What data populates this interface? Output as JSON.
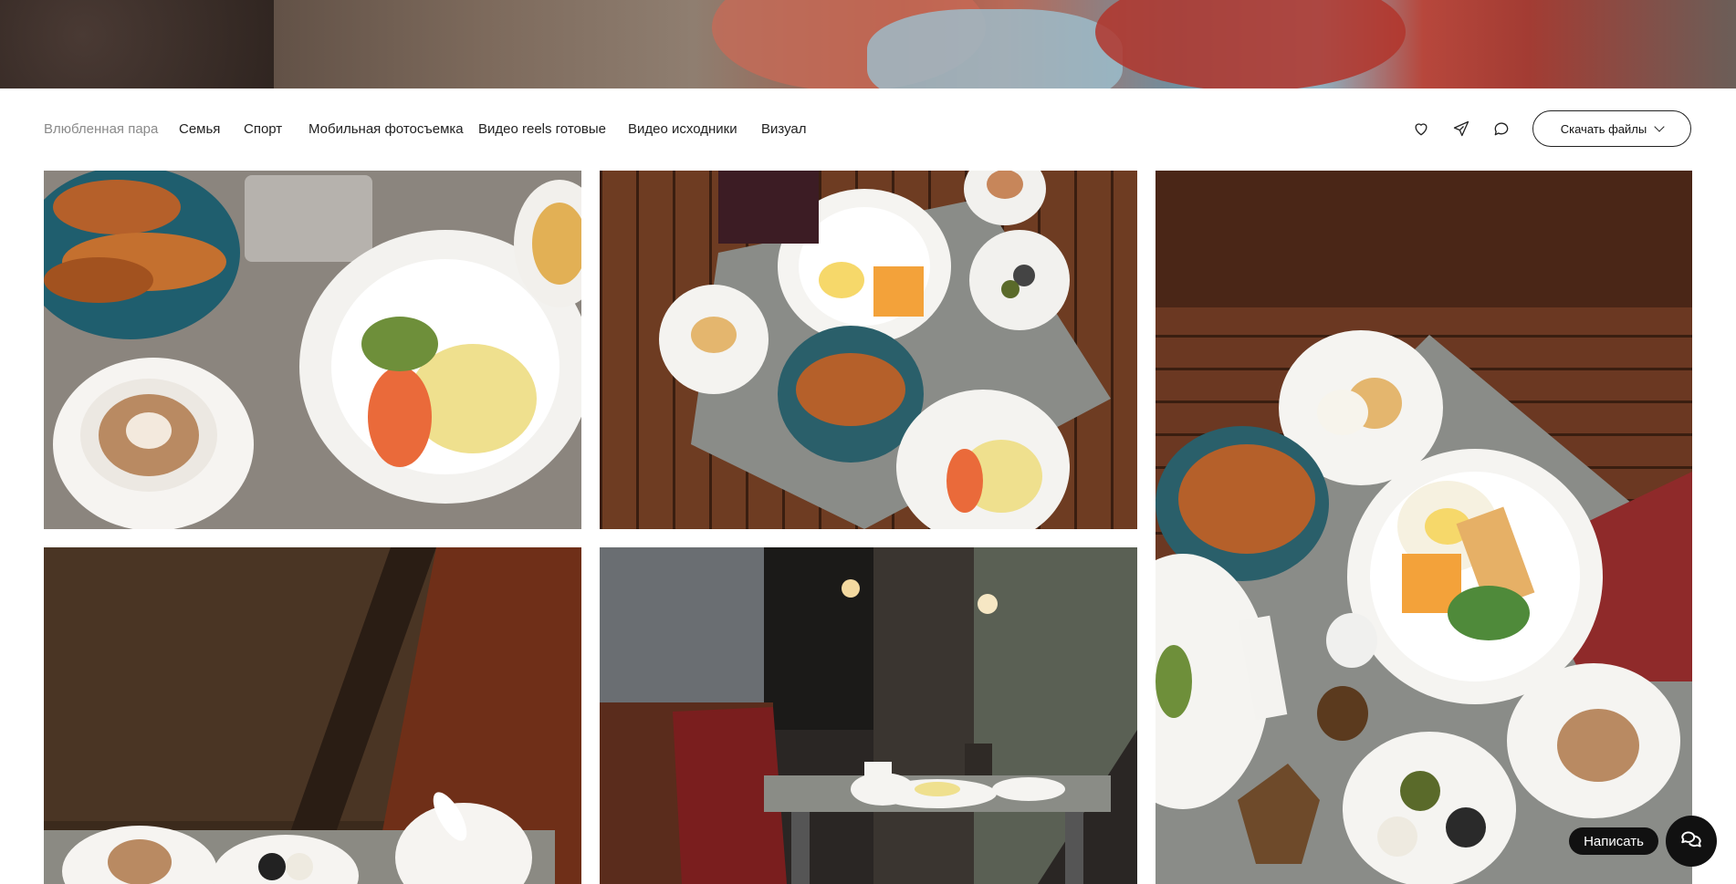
{
  "nav": {
    "items": [
      {
        "label": "Влюбленная пара",
        "active": true
      },
      {
        "label": "Семья",
        "active": false
      },
      {
        "label": "Спорт",
        "active": false
      },
      {
        "label": "Мобильная фотосъемка",
        "active": false
      },
      {
        "label": "Видео reels готовые",
        "active": false
      },
      {
        "label": "Видео исходники",
        "active": false
      },
      {
        "label": "Визуал",
        "active": false
      }
    ]
  },
  "toolbar": {
    "icons": [
      "heart-icon",
      "send-icon",
      "comment-icon"
    ],
    "download_label": "Скачать файлы"
  },
  "gallery": {
    "photos": [
      {
        "name": "breakfast-plate-closeup"
      },
      {
        "name": "breakfast-table-overhead"
      },
      {
        "name": "breakfast-table-tall"
      },
      {
        "name": "window-table-coffee"
      },
      {
        "name": "terrace-table-scene"
      }
    ]
  },
  "chat": {
    "label": "Написать"
  },
  "colors": {
    "text": "#222222",
    "active_nav": "#8a8a8a",
    "dark": "#111111",
    "background": "#ffffff"
  }
}
